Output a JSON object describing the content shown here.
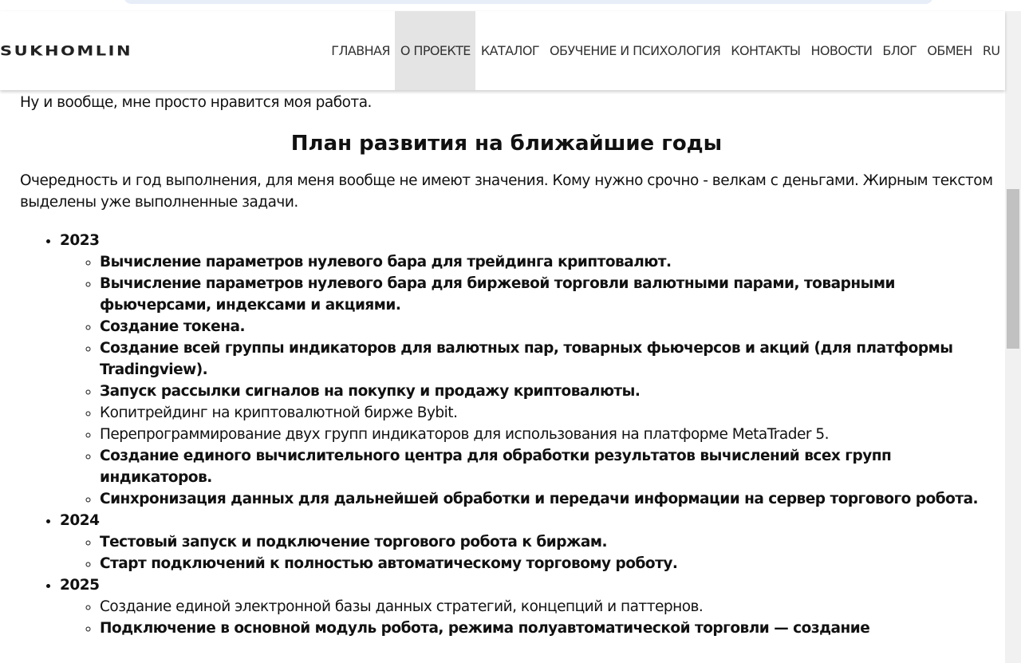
{
  "header": {
    "logo": "SUKHOMLIN",
    "nav": [
      "ГЛАВНАЯ",
      "О ПРОЕКТЕ",
      "КАТАЛОГ",
      "ОБУЧЕНИЕ И ПСИХОЛОГИЯ",
      "КОНТАКТЫ",
      "НОВОСТИ",
      "БЛОГ",
      "ОБМЕН",
      "RU"
    ],
    "active": "О ПРОЕКТЕ"
  },
  "content": {
    "intro": "Ну и вообще, мне просто нравится моя работа.",
    "heading": "План развития на ближайшие годы",
    "para": "Очередность и год выполнения, для меня вообще не имеют значения. Кому нужно срочно - велкам с деньгами. Жирным текстом выделены уже выполненные задачи.",
    "years": [
      {
        "year": "2023",
        "items": [
          {
            "text": "Вычисление параметров нулевого бара для трейдинга криптовалют.",
            "done": true
          },
          {
            "text": "Вычисление параметров нулевого бара для биржевой торговли валютными парами, товарными фьючерсами, индексами и акциями.",
            "done": true
          },
          {
            "text": "Создание токена.",
            "done": true
          },
          {
            "text": "Создание всей группы индикаторов для валютных пар, товарных фьючерсов и акций (для платформы Tradingview).",
            "done": true
          },
          {
            "text": "Запуск рассылки сигналов на покупку и продажу криптовалюты.",
            "done": true
          },
          {
            "text": "Копитрейдинг на криптовалютной бирже Bybit.",
            "done": false
          },
          {
            "text": "Перепрограммирование двух групп индикаторов для использования на платформе MetaTrader 5.",
            "done": false
          },
          {
            "text": "Создание единого вычислительного центра для обработки результатов вычислений всех групп индикаторов.",
            "done": true
          },
          {
            "text": "Синхронизация данных для дальнейшей обработки и передачи информации на сервер торгового робота.",
            "done": true
          }
        ]
      },
      {
        "year": "2024",
        "items": [
          {
            "text": "Тестовый запуск и подключение торгового робота к биржам.",
            "done": true
          },
          {
            "text": "Старт подключений к полностью автоматическому торговому роботу.",
            "done": true
          }
        ]
      },
      {
        "year": "2025",
        "items": [
          {
            "text": "Создание единой электронной базы данных стратегий, концепций и паттернов.",
            "done": false
          },
          {
            "text": "Подключение в основной модуль робота, режима полуавтоматической торговли — создание",
            "done": true
          }
        ]
      }
    ]
  }
}
